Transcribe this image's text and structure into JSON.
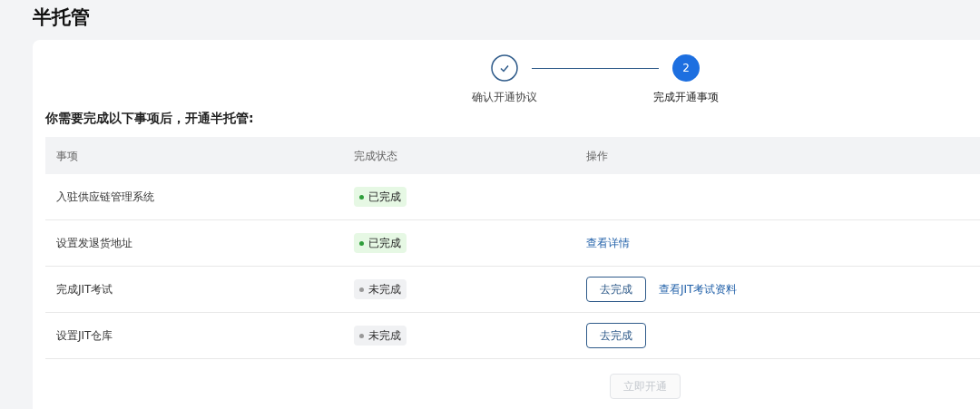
{
  "page_title": "半托管",
  "steps": [
    {
      "label": "确认开通协议",
      "done": true,
      "current": false
    },
    {
      "number": "2",
      "label": "完成开通事项",
      "done": false,
      "current": true
    }
  ],
  "instruction": "你需要完成以下事项后，开通半托管:",
  "table": {
    "columns": [
      "事项",
      "完成状态",
      "操作"
    ],
    "rows": [
      {
        "item": "入驻供应链管理系统",
        "status": "已完成",
        "completed": true,
        "actions": []
      },
      {
        "item": "设置发退货地址",
        "status": "已完成",
        "completed": true,
        "actions": [
          {
            "kind": "link",
            "label": "查看详情"
          }
        ]
      },
      {
        "item": "完成JIT考试",
        "status": "未完成",
        "completed": false,
        "actions": [
          {
            "kind": "button",
            "label": "去完成"
          },
          {
            "kind": "link",
            "label": "查看JIT考试资料"
          }
        ]
      },
      {
        "item": "设置JIT仓库",
        "status": "未完成",
        "completed": false,
        "actions": [
          {
            "kind": "button",
            "label": "去完成"
          }
        ]
      }
    ]
  },
  "submit": {
    "label": "立即开通",
    "disabled": true
  }
}
